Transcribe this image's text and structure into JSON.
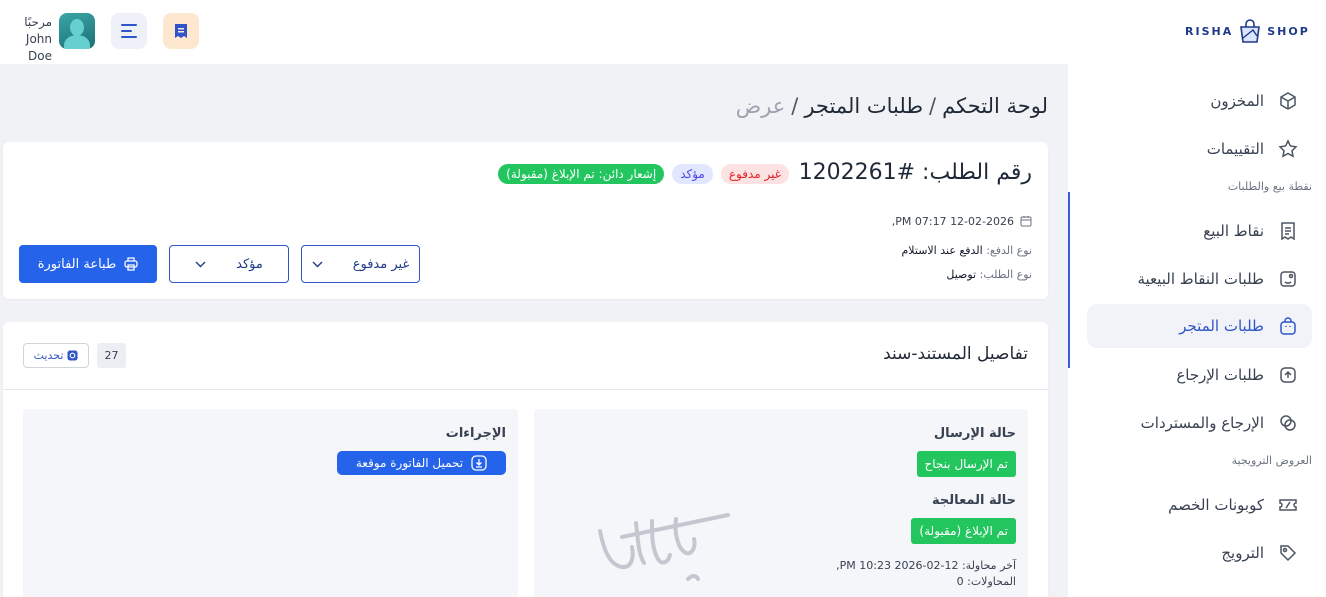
{
  "header": {
    "greeting": "مرحبًا",
    "user_name": "John Doe",
    "logo_left": "RISHA",
    "logo_right": "SHOP",
    "icons": {
      "menu": "menu-lines-icon",
      "pos": "receipt-icon",
      "avatar": "user-avatar"
    }
  },
  "sidebar": {
    "items_top": [
      {
        "label": "المخزون",
        "icon": "box-icon"
      },
      {
        "label": "التقييمات",
        "icon": "star-icon"
      }
    ],
    "section_pos": "نقطة بيع والطلبات",
    "items_pos": [
      {
        "label": "نقاط البيع",
        "icon": "receipt-icon"
      },
      {
        "label": "طلبات النقاط البيعية",
        "icon": "pos-orders-icon"
      },
      {
        "label": "طلبات المتجر",
        "icon": "shopping-bag-icon",
        "active": true
      },
      {
        "label": "طلبات الإرجاع",
        "icon": "return-box-icon"
      },
      {
        "label": "الإرجاع والمستردات",
        "icon": "refund-icon"
      }
    ],
    "section_promo": "العروض الترويجية",
    "items_promo": [
      {
        "label": "كوبونات الخصم",
        "icon": "coupon-icon"
      },
      {
        "label": "الترويج",
        "icon": "tag-icon"
      }
    ]
  },
  "breadcrumb": [
    "لوحة التحكم",
    "طلبات المتجر",
    "عرض"
  ],
  "order": {
    "title": "رقم الطلب: #1202261",
    "badges": {
      "unpaid": "غير مدفوع",
      "confirmed": "مؤكد",
      "notify": "إشعار دائن: تم الإبلاغ (مقبولة)"
    },
    "datetime": "12-02-2026 07:17 PM,",
    "payment_label": "نوع الدفع:",
    "payment_value": "الدفع عند الاستلام",
    "type_label": "نوع الطلب:",
    "type_value": "توصيل",
    "payment_select": "غير مدفوع",
    "status_select": "مؤكد",
    "print_label": "طباعة الفاتورة"
  },
  "document": {
    "title": "تفاصيل المستند-سند",
    "count": "27",
    "refresh_label": "تحديث",
    "send_status_label": "حالة الإرسال",
    "send_status_value": "تم الإرسال بنجاح",
    "processing_label": "حالة المعالجة",
    "processing_value": "تم الإبلاغ (مقبولة)",
    "last_attempt": "آخر محاولة: 12-02-2026 10:23 PM,",
    "attempts": "المحاولات: 0",
    "actions_label": "الإجراءات",
    "download_label": "تحميل الفاتورة موقعة"
  },
  "colors": {
    "primary": "#2563eb",
    "success": "#22c55e",
    "danger": "#dc2626",
    "active_nav": "#2f55c9"
  }
}
